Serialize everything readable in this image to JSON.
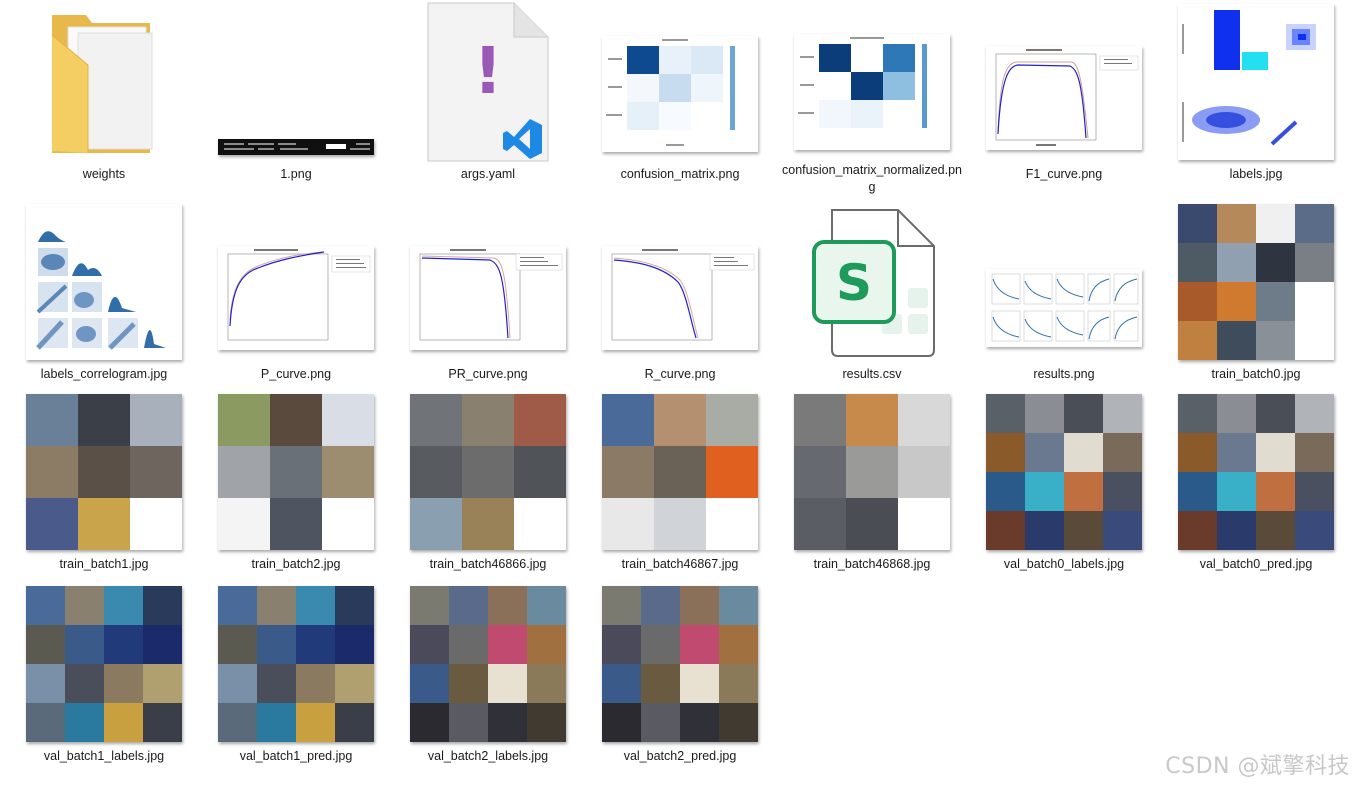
{
  "files": [
    {
      "name": "weights",
      "kind": "folder"
    },
    {
      "name": "1.png",
      "kind": "terminal"
    },
    {
      "name": "args.yaml",
      "kind": "yaml"
    },
    {
      "name": "confusion_matrix.png",
      "kind": "cm"
    },
    {
      "name": "confusion_matrix_normalized.png",
      "kind": "cmn"
    },
    {
      "name": "F1_curve.png",
      "kind": "curve-f1"
    },
    {
      "name": "labels.jpg",
      "kind": "labels"
    },
    {
      "name": "labels_correlogram.jpg",
      "kind": "correlogram"
    },
    {
      "name": "P_curve.png",
      "kind": "curve-p"
    },
    {
      "name": "PR_curve.png",
      "kind": "curve-pr"
    },
    {
      "name": "R_curve.png",
      "kind": "curve-r"
    },
    {
      "name": "results.csv",
      "kind": "csv"
    },
    {
      "name": "results.png",
      "kind": "results"
    },
    {
      "name": "train_batch0.jpg",
      "kind": "photo"
    },
    {
      "name": "train_batch1.jpg",
      "kind": "photo"
    },
    {
      "name": "train_batch2.jpg",
      "kind": "photo"
    },
    {
      "name": "train_batch46866.jpg",
      "kind": "photo-gray"
    },
    {
      "name": "train_batch46867.jpg",
      "kind": "photo"
    },
    {
      "name": "train_batch46868.jpg",
      "kind": "photo-gray"
    },
    {
      "name": "val_batch0_labels.jpg",
      "kind": "photo-val"
    },
    {
      "name": "val_batch0_pred.jpg",
      "kind": "photo-val"
    },
    {
      "name": "val_batch1_labels.jpg",
      "kind": "photo-val"
    },
    {
      "name": "val_batch1_pred.jpg",
      "kind": "photo-val"
    },
    {
      "name": "val_batch2_labels.jpg",
      "kind": "photo-val"
    },
    {
      "name": "val_batch2_pred.jpg",
      "kind": "photo-val"
    }
  ],
  "csv_icon_letter": "S",
  "yaml_icon_letter": "!",
  "watermark": "CSDN @斌擎科技"
}
